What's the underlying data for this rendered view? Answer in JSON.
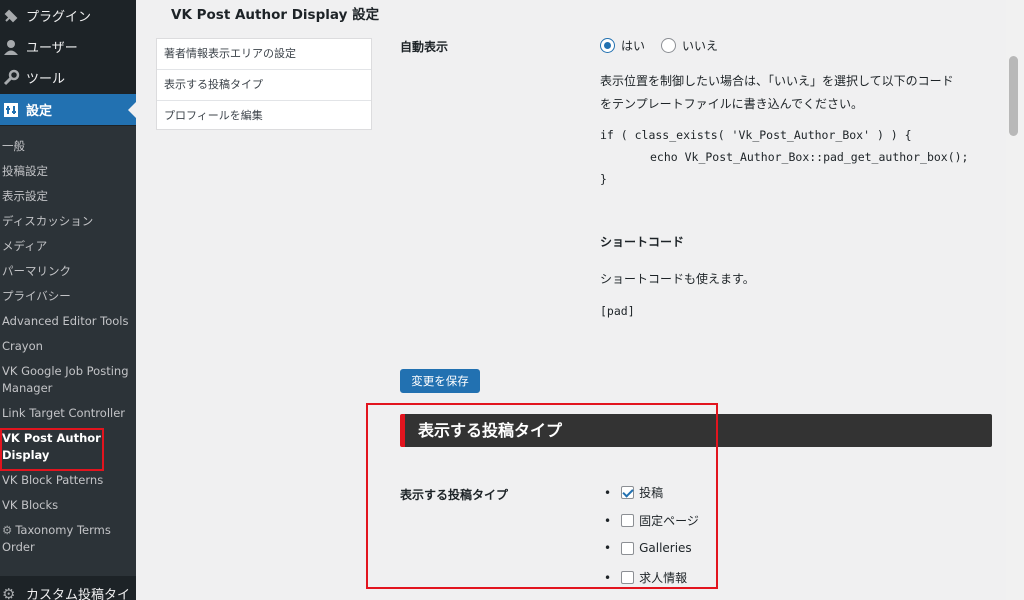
{
  "sidebar": {
    "top_items": [
      {
        "label": "プラグイン",
        "icon": "plugin-icon"
      },
      {
        "label": "ユーザー",
        "icon": "user-icon"
      },
      {
        "label": "ツール",
        "icon": "wrench-icon"
      },
      {
        "label": "設定",
        "icon": "settings-icon"
      }
    ],
    "sub_items": [
      "一般",
      "投稿設定",
      "表示設定",
      "ディスカッション",
      "メディア",
      "パーマリンク",
      "プライバシー",
      "Advanced Editor Tools",
      "Crayon",
      "VK Google Job Posting Manager",
      "Link Target Controller",
      "VK Post Author Display",
      "VK Block Patterns",
      "VK Blocks",
      "Taxonomy Terms Order"
    ],
    "bottom_item": "カスタム投稿タイ"
  },
  "main": {
    "title": "VK Post Author Display 設定",
    "nav_links": [
      "著者情報表示エリアの設定",
      "表示する投稿タイプ",
      "プロフィールを編集"
    ],
    "auto_display": {
      "label": "自動表示",
      "option_yes": "はい",
      "option_no": "いいえ",
      "selected": "はい",
      "description_line1": "表示位置を制御したい場合は、「いいえ」を選択して以下のコード",
      "description_line2": "をテンプレートファイルに書き込んでください。",
      "code_line1": "if ( class_exists( 'Vk_Post_Author_Box' ) ) {",
      "code_line2": "echo Vk_Post_Author_Box::pad_get_author_box();",
      "code_line3": "}"
    },
    "shortcode": {
      "heading": "ショートコード",
      "text": "ショートコードも使えます。",
      "code": "[pad]"
    },
    "save_button": "変更を保存",
    "post_types_section": {
      "header": "表示する投稿タイプ",
      "label": "表示する投稿タイプ",
      "items": [
        {
          "label": "投稿",
          "checked": true
        },
        {
          "label": "固定ページ",
          "checked": false
        },
        {
          "label": "Galleries",
          "checked": false
        },
        {
          "label": "求人情報",
          "checked": false
        }
      ]
    }
  },
  "colors": {
    "sidebar_bg": "#1d2327",
    "accent": "#2271b1",
    "highlight": "#e2141e"
  }
}
